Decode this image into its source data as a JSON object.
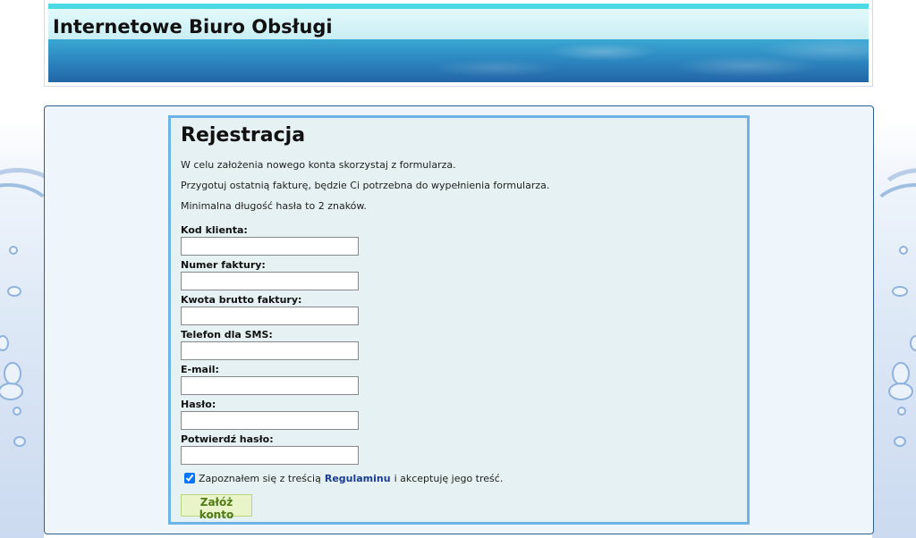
{
  "header": {
    "title": "Internetowe Biuro Obsługi"
  },
  "form": {
    "heading": "Rejestracja",
    "info": [
      "W celu założenia nowego konta skorzystaj z formularza.",
      "Przygotuj ostatnią fakturę, będzie Ci potrzebna do wypełnienia formularza.",
      "Minimalna długość hasła to 2 znaków."
    ],
    "fields": {
      "client_code": {
        "label": "Kod klienta:",
        "value": ""
      },
      "invoice_number": {
        "label": "Numer faktury:",
        "value": ""
      },
      "gross_amount": {
        "label": "Kwota brutto faktury:",
        "value": ""
      },
      "sms_phone": {
        "label": "Telefon dla SMS:",
        "value": ""
      },
      "email": {
        "label": "E-mail:",
        "value": ""
      },
      "password": {
        "label": "Hasło:",
        "value": ""
      },
      "confirm_password": {
        "label": "Potwierdź hasło:",
        "value": ""
      }
    },
    "accept": {
      "checked": true,
      "prefix": "Zapoznałem się z treścią",
      "link": "Regulaminu",
      "suffix": "i akceptuję jego treść."
    },
    "submit_label": "Załóż konto"
  },
  "colors": {
    "panel_border": "#2f5f8f",
    "form_border": "#6db3e6",
    "link": "#1a3d8f",
    "button_text": "#4f7a16"
  }
}
